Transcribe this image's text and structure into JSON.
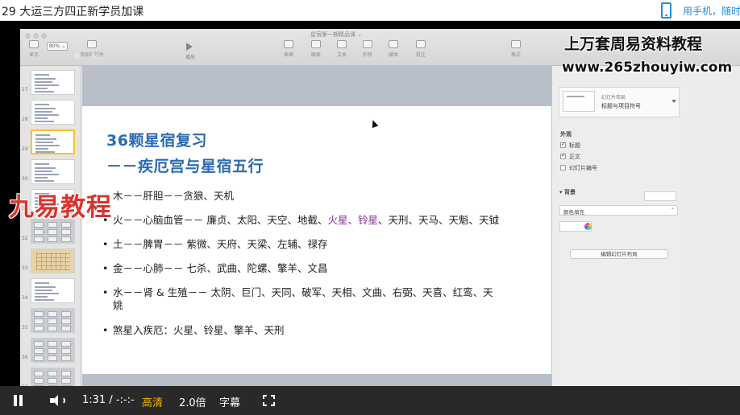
{
  "page": {
    "title": "29 大运三方四正新学员加课",
    "mobile_link": "用手机，随时"
  },
  "keynote": {
    "doc_title": "星宿第一期精品课 ⌄",
    "toolbar": {
      "view": "显示",
      "zoom": "80% ⌄",
      "add_slide": "添加幻灯片",
      "play": "播放",
      "table": "表格",
      "chart": "图表",
      "text": "文本",
      "shape": "形状",
      "media": "媒体",
      "comment": "批注",
      "format": "格式"
    },
    "navigator": [
      {
        "num": "27",
        "kind": "text"
      },
      {
        "num": "28",
        "kind": "text"
      },
      {
        "num": "29",
        "kind": "text"
      },
      {
        "num": "30",
        "kind": "text"
      },
      {
        "num": "31",
        "kind": "text"
      },
      {
        "num": "32",
        "kind": "grid"
      },
      {
        "num": "33",
        "kind": "table"
      },
      {
        "num": "34",
        "kind": "text"
      },
      {
        "num": "35",
        "kind": "grid"
      },
      {
        "num": "36",
        "kind": "grid"
      },
      {
        "num": "37",
        "kind": "grid"
      }
    ],
    "slide": {
      "title_line1": "36颗星宿复习",
      "title_line2": "－－疾厄宫与星宿五行",
      "bullets": [
        {
          "text": "木－－肝胆－－贪狼、天机"
        },
        {
          "before": "火－－心脑血管－－ 廉贞、太阳、天空、地截、",
          "highlight": "火星、铃星",
          "after": "、天刑、天马、天魁、天钺"
        },
        {
          "text": "土－－脾胃－－ 紫微、天府、天梁、左辅、禄存"
        },
        {
          "text": "金－－心肺－－ 七杀、武曲、陀螺、擎羊、文昌"
        },
        {
          "text": "水－－肾 & 生殖－－ 太阴、巨门、天同、破军、天相、文曲、右弼、天喜、红鸾、天",
          "text2": "姚"
        },
        {
          "text": "煞星入疾厄：火星、铃星、擎羊、天刑"
        }
      ]
    },
    "inspector": {
      "layout_label": "幻灯片布局",
      "layout_value": "标题与项目符号",
      "appearance": "外观",
      "title_check": "标题",
      "body_check": "正文",
      "number_check": "幻灯片编号",
      "background": "背景",
      "fill_type": "颜色填充",
      "edit_layout": "编辑幻灯片布局"
    }
  },
  "watermarks": {
    "left": "九易教程",
    "title": "上万套周易资料教程",
    "url": "www.265zhouyiw.com"
  },
  "player": {
    "time": "1:31 / -:-:-",
    "quality": "高清",
    "speed": "2.0倍",
    "subtitle": "字幕"
  },
  "colors": {
    "slide_title": "#2b6bb2",
    "highlight": "#8c2aa6",
    "watermark_red": "#d8342f",
    "quality_active": "#f5b400"
  }
}
